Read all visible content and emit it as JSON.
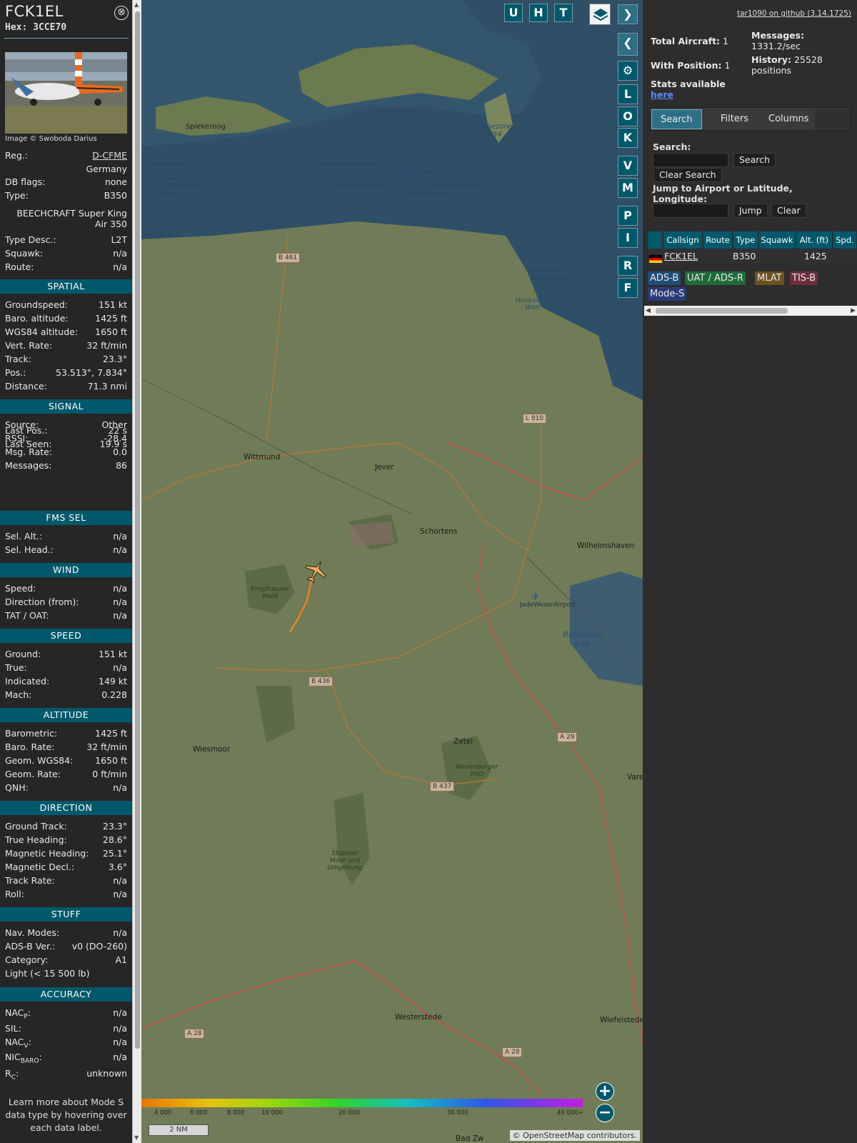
{
  "aircraft": {
    "callsign": "FCK1EL",
    "hex_label": "Hex:",
    "hex": "3CCE70",
    "close_glyph": "⊗",
    "photo_credit": "Image © Swoboda Darius"
  },
  "info": {
    "reg_label": "Reg.:",
    "reg": "D-CFME",
    "country": "Germany",
    "dbflags_label": "DB flags:",
    "dbflags": "none",
    "type_label": "Type:",
    "type": "B350",
    "type_name": "BEECHCRAFT Super King Air 350",
    "typedesc_label": "Type Desc.:",
    "typedesc": "L2T",
    "squawk_label": "Squawk:",
    "squawk": "n/a",
    "route_label": "Route:",
    "route": "n/a"
  },
  "sections": {
    "spatial": "SPATIAL",
    "signal": "SIGNAL",
    "fms": "FMS SEL",
    "wind": "WIND",
    "speed": "SPEED",
    "altitude": "ALTITUDE",
    "direction": "DIRECTION",
    "stuff": "STUFF",
    "accuracy": "ACCURACY"
  },
  "spatial": [
    {
      "label": "Groundspeed:",
      "value": "151 kt"
    },
    {
      "label": "Baro. altitude:",
      "value": "1425 ft"
    },
    {
      "label": "WGS84 altitude:",
      "value": "1650 ft"
    },
    {
      "label": "Vert. Rate:",
      "value": "32 ft/min"
    },
    {
      "label": "Track:",
      "value": "23.3°"
    },
    {
      "label": "Pos.:",
      "value": "53.513°, 7.834°"
    },
    {
      "label": "Distance:",
      "value": "71.3 nmi"
    }
  ],
  "signal": [
    {
      "label": "Source:",
      "value": "Other"
    },
    {
      "label": "RSSI:",
      "value": "-28.4"
    },
    {
      "label": "Msg. Rate:",
      "value": "0.0"
    },
    {
      "label": "Messages:",
      "value": "86"
    },
    {
      "label": "Last Pos.:",
      "value": "22 s"
    },
    {
      "label": "Last Seen:",
      "value": "19.9 s"
    }
  ],
  "fms": [
    {
      "label": "Sel. Alt.:",
      "value": "n/a"
    },
    {
      "label": "Sel. Head.:",
      "value": "n/a"
    }
  ],
  "wind": [
    {
      "label": "Speed:",
      "value": "n/a"
    },
    {
      "label": "Direction (from):",
      "value": "n/a"
    },
    {
      "label": "TAT / OAT:",
      "value": "n/a"
    }
  ],
  "speed": [
    {
      "label": "Ground:",
      "value": "151 kt"
    },
    {
      "label": "True:",
      "value": "n/a"
    },
    {
      "label": "Indicated:",
      "value": "149 kt"
    },
    {
      "label": "Mach:",
      "value": "0.228"
    }
  ],
  "altitude": [
    {
      "label": "Barometric:",
      "value": "1425 ft"
    },
    {
      "label": "Baro. Rate:",
      "value": "32 ft/min"
    },
    {
      "label": "Geom. WGS84:",
      "value": "1650 ft"
    },
    {
      "label": "Geom. Rate:",
      "value": "0 ft/min"
    },
    {
      "label": "QNH:",
      "value": "n/a"
    }
  ],
  "direction": [
    {
      "label": "Ground Track:",
      "value": "23.3°"
    },
    {
      "label": "True Heading:",
      "value": "28.6°"
    },
    {
      "label": "Magnetic Heading:",
      "value": "25.1°"
    },
    {
      "label": "Magnetic Decl.:",
      "value": "3.6°"
    },
    {
      "label": "Track Rate:",
      "value": "n/a"
    },
    {
      "label": "Roll:",
      "value": "n/a"
    }
  ],
  "stuff": [
    {
      "label": "Nav. Modes:",
      "value": "n/a"
    },
    {
      "label": "ADS-B Ver.:",
      "value": "v0 (DO-260)"
    },
    {
      "label": "Category:",
      "value": "A1"
    }
  ],
  "stuff_category_desc": "Light (< 15 500 lb)",
  "accuracy": {
    "nacp_main": "NAC",
    "nacp_sub": "P",
    "nacp": "n/a",
    "sil_label": "SIL:",
    "sil": "n/a",
    "nacv_main": "NAC",
    "nacv_sub": "V",
    "nacv": "n/a",
    "nicbaro_main": "NIC",
    "nicbaro_sub": "BARO",
    "nicbaro": "n/a",
    "rc_main": "R",
    "rc_sub": "C",
    "rc": "unknown",
    "colon": ":"
  },
  "footnote": "Learn more about Mode S data type by hovering over each data label.",
  "map": {
    "buttons_top": [
      "U",
      "H",
      "T"
    ],
    "side_buttons": [
      "L",
      "O",
      "K",
      "V",
      "M",
      "P",
      "I",
      "R",
      "F"
    ],
    "layers_icon": "layers-icon",
    "expand_glyph": "❯",
    "collapse_glyph": "❮",
    "toggle_glyph": "◂▸",
    "gear_glyph": "⚙",
    "zoom_in": "+",
    "zoom_out": "−",
    "scale": "2 NM",
    "attribution_prefix": "© ",
    "attribution_link": "OpenStreetMap",
    "attribution_suffix": " contributors.",
    "altitude_legend": [
      "4 000",
      "6 000",
      "8 000",
      "10 000",
      "20 000",
      "30 000",
      "40 000+"
    ],
    "labels": {
      "spiekeroog": "Spiekeroog",
      "wangerooge_inselwatt": "Wangerooger Inselwatt",
      "wangerooger_plate": "Wangerooger Plate",
      "ruhezone_129": "Ruhezone I/29",
      "hohe_bank": "Hohe Bank",
      "hoher_rucken": "Hoher Rücken",
      "ruhezone_131": "Ruhezone I/31",
      "harlesieler_watt": "Harlesieler Watt",
      "harlesieler_watt2": "Harlesieler Watt",
      "wanger_watt": "Wanger Watt",
      "neues_brack": "Neues Brack",
      "ruhezone_134": "Ruhezone I/34",
      "janssand": "Janssand Ruhezone I/27",
      "hooksieler_watt": "Hooksieler Watt",
      "ruhezone_136": "Ruhezone I/36",
      "wittmund": "Wittmund",
      "jever": "Jever",
      "schortens": "Schortens",
      "wilhelmshaven": "Wilhelmshaven",
      "jadeweserairport": "JadeWeserAirport",
      "knyphauser_wald": "Knyphauser Wald",
      "wiesmoor": "Wiesmoor",
      "zetel": "Zetel",
      "neuenburger_holz": "Neuenburger Holz",
      "stapeler": "Stapeler Moor und Umgebung",
      "westerstede": "Westerstede",
      "wiefelstede": "Wiefelstede",
      "vare": "Vare",
      "bad_zw": "Bad Zw",
      "riemer": "Riemer Watt"
    },
    "roads": {
      "b461": "B 461",
      "l810": "L 810",
      "b436": "B 436",
      "b437": "B 437",
      "a29": "A 29",
      "a28a": "A 28",
      "a28b": "A 28"
    }
  },
  "sidebar": {
    "github": "tar1090 on github (3.14.1725)",
    "total_label": "Total Aircraft:",
    "total": "1",
    "withpos_label": "With Position:",
    "withpos": "1",
    "stats_label": "Stats available",
    "stats_link": "here",
    "messages_label": "Messages:",
    "messages": "1331.2/sec",
    "history_label": "History:",
    "history": "25528 positions",
    "tabs": [
      "Search",
      "Filters",
      "Columns"
    ],
    "search_label": "Search:",
    "search_button": "Search",
    "clear_search": "Clear Search",
    "jump_label": "Jump to Airport or Latitude, Longitude:",
    "jump_button": "Jump",
    "clear_button": "Clear",
    "columns": [
      "",
      "Callsign",
      "Route",
      "Type",
      "Squawk",
      "Alt. (ft)",
      "Spd."
    ],
    "row": {
      "callsign": "FCK1EL",
      "route": "",
      "type": "B350",
      "squawk": "",
      "alt": "1425"
    },
    "badges": [
      {
        "label": "ADS-B",
        "color": "#1f4e79"
      },
      {
        "label": "UAT / ADS-R",
        "color": "#1e6b3a"
      },
      {
        "label": "MLAT",
        "color": "#6b5320"
      },
      {
        "label": "TIS-B",
        "color": "#6e2f3c"
      },
      {
        "label": "Mode-S",
        "color": "#2b3a78"
      }
    ]
  }
}
